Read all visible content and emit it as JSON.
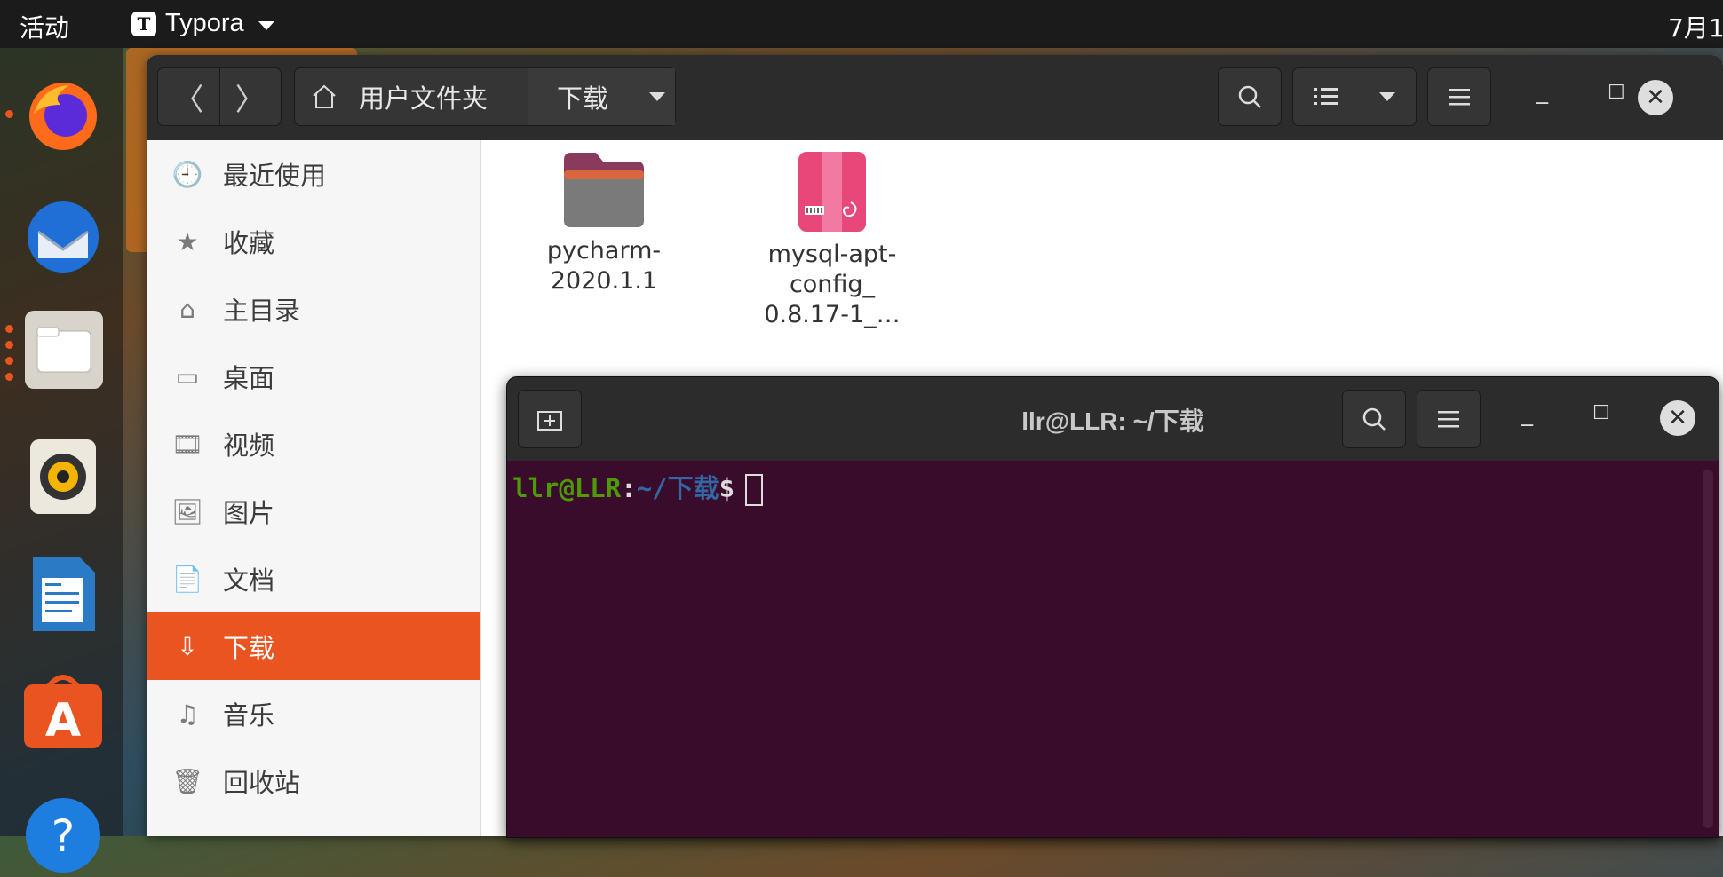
{
  "topbar": {
    "activities": "活动",
    "app_icon_letter": "T",
    "app_name": "Typora",
    "clock": "7月1"
  },
  "dock": {
    "items": [
      "firefox-icon",
      "thunderbird-icon",
      "files-icon",
      "rhythmbox-icon",
      "libreoffice-writer-icon",
      "app-center-icon",
      "help-icon"
    ]
  },
  "files": {
    "path_home": "用户文件夹",
    "path_current": "下载",
    "sidebar": [
      {
        "icon": "🕘",
        "label": "最近使用"
      },
      {
        "icon": "★",
        "label": "收藏"
      },
      {
        "icon": "⌂",
        "label": "主目录"
      },
      {
        "icon": "▭",
        "label": "桌面"
      },
      {
        "icon": "🎞",
        "label": "视频"
      },
      {
        "icon": "🖼",
        "label": "图片"
      },
      {
        "icon": "📄",
        "label": "文档"
      },
      {
        "icon": "⇩",
        "label": "下载",
        "active": true
      },
      {
        "icon": "♫",
        "label": "音乐"
      },
      {
        "icon": "🗑",
        "label": "回收站"
      }
    ],
    "items": [
      {
        "name_line1": "pycharm-",
        "name_line2": "2020.1.1",
        "name_line3": "",
        "type": "folder"
      },
      {
        "name_line1": "mysql-apt-",
        "name_line2": "config_",
        "name_line3": "0.8.17-1_…",
        "type": "deb"
      }
    ]
  },
  "terminal": {
    "title": "llr@LLR: ~/下载",
    "prompt_user": "llr@LLR",
    "prompt_colon": ":",
    "prompt_path": "~/下载",
    "prompt_dollar": "$"
  },
  "colors": {
    "accent": "#e95420",
    "terminal_bg": "#380c2a"
  }
}
